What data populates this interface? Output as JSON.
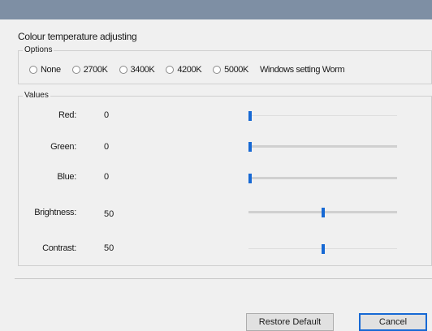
{
  "window": {
    "heading": "Colour temperature adjusting"
  },
  "options": {
    "group_label": "Options",
    "radios": [
      {
        "label": "None"
      },
      {
        "label": "2700K"
      },
      {
        "label": "3400K"
      },
      {
        "label": "4200K"
      },
      {
        "label": "5000K"
      },
      {
        "label": "Windows setting Worm"
      }
    ]
  },
  "values": {
    "group_label": "Values",
    "rows": [
      {
        "label": "Red:",
        "value": "0",
        "level": 0.0
      },
      {
        "label": "Green:",
        "value": "0",
        "level": 0.0
      },
      {
        "label": "Blue:",
        "value": "0",
        "level": 0.0
      },
      {
        "label": "Brightness:",
        "value": "50",
        "level": 0.5
      },
      {
        "label": "Contrast:",
        "value": "50",
        "level": 0.5
      }
    ]
  },
  "buttons": {
    "restore_default": "Restore Default",
    "cancel": "Cancel"
  },
  "colors": {
    "accent": "#1769d4",
    "titlebar": "#7e8fa4"
  }
}
